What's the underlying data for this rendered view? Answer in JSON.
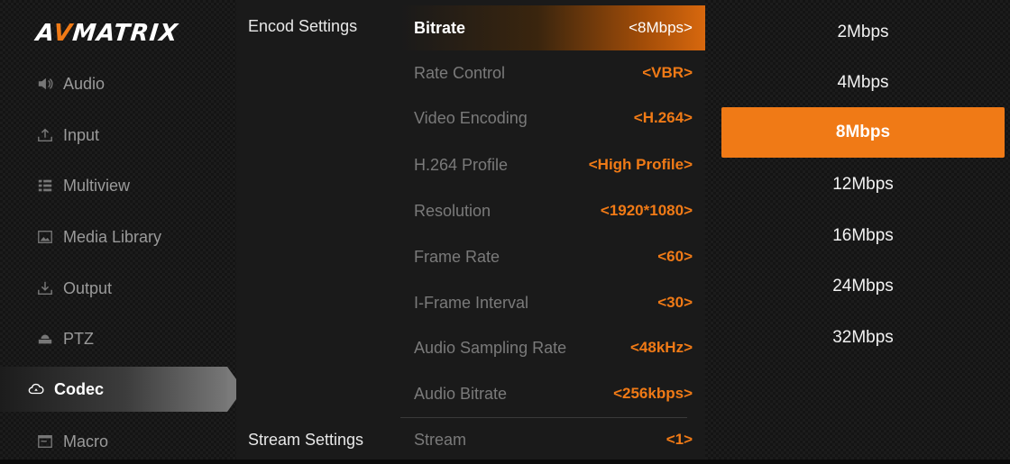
{
  "brand": {
    "logo_prefix": "A",
    "logo_v": "V",
    "logo_suffix": "MATRIX",
    "accent": "#f07a16"
  },
  "sidebar": {
    "items": [
      {
        "label": "Audio",
        "icon": "speaker-icon"
      },
      {
        "label": "Input",
        "icon": "upload-icon"
      },
      {
        "label": "Multiview",
        "icon": "list-icon"
      },
      {
        "label": "Media Library",
        "icon": "image-icon"
      },
      {
        "label": "Output",
        "icon": "download-icon"
      },
      {
        "label": "PTZ",
        "icon": "camera-icon"
      },
      {
        "label": "Codec",
        "icon": "cloud-icon",
        "active": true
      },
      {
        "label": "Macro",
        "icon": "window-icon"
      }
    ]
  },
  "sections": {
    "encode": "Encod Settings",
    "stream": "Stream Settings"
  },
  "settings": [
    {
      "label": "Bitrate",
      "value": "<8Mbps>",
      "active": true
    },
    {
      "label": "Rate Control",
      "value": "<VBR>"
    },
    {
      "label": "Video Encoding",
      "value": "<H.264>"
    },
    {
      "label": "H.264 Profile",
      "value": "<High Profile>"
    },
    {
      "label": "Resolution",
      "value": "<1920*1080>"
    },
    {
      "label": "Frame Rate",
      "value": "<60>"
    },
    {
      "label": "I-Frame Interval",
      "value": "<30>"
    },
    {
      "label": "Audio Sampling Rate",
      "value": "<48kHz>"
    },
    {
      "label": "Audio Bitrate",
      "value": "<256kbps>"
    },
    {
      "label": "Stream",
      "value": "<1>"
    }
  ],
  "options": [
    {
      "label": "2Mbps"
    },
    {
      "label": "4Mbps"
    },
    {
      "label": "8Mbps",
      "selected": true
    },
    {
      "label": "12Mbps"
    },
    {
      "label": "16Mbps"
    },
    {
      "label": "24Mbps"
    },
    {
      "label": "32Mbps"
    }
  ]
}
